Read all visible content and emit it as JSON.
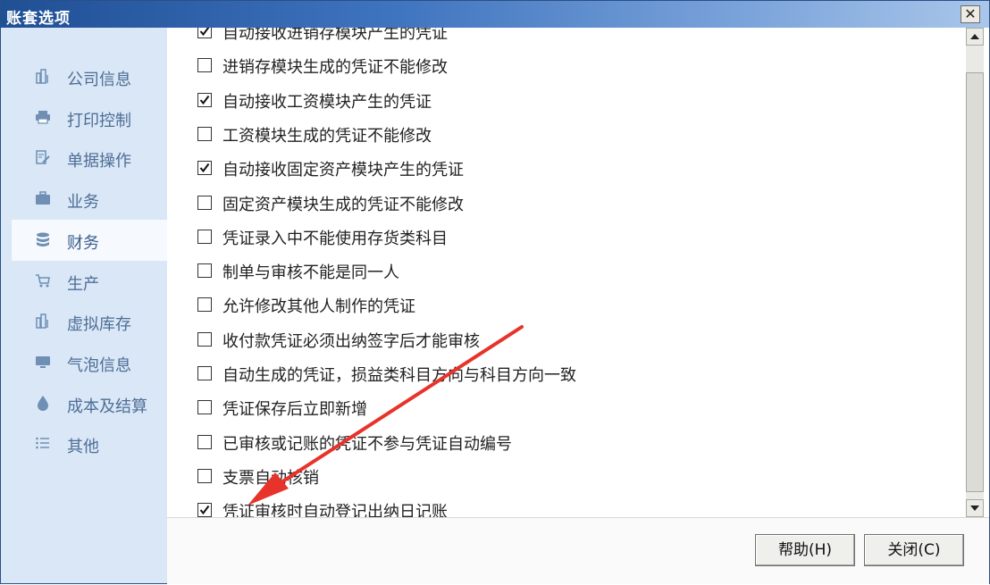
{
  "window": {
    "title": "账套选项"
  },
  "titlebar": {
    "close_glyph": "✕"
  },
  "sidebar": {
    "items": [
      {
        "label": "公司信息",
        "icon": "building-icon",
        "active": false
      },
      {
        "label": "打印控制",
        "icon": "printer-icon",
        "active": false
      },
      {
        "label": "单据操作",
        "icon": "document-edit-icon",
        "active": false
      },
      {
        "label": "业务",
        "icon": "briefcase-icon",
        "active": false
      },
      {
        "label": "财务",
        "icon": "database-icon",
        "active": true
      },
      {
        "label": "生产",
        "icon": "cart-icon",
        "active": false
      },
      {
        "label": "虚拟库存",
        "icon": "building-icon",
        "active": false
      },
      {
        "label": "气泡信息",
        "icon": "monitor-icon",
        "active": false
      },
      {
        "label": "成本及结算",
        "icon": "drop-icon",
        "active": false
      },
      {
        "label": "其他",
        "icon": "list-icon",
        "active": false
      }
    ]
  },
  "options": [
    {
      "label": "自动接收进销存模块产生的凭证",
      "checked": true
    },
    {
      "label": "进销存模块生成的凭证不能修改",
      "checked": false
    },
    {
      "label": "自动接收工资模块产生的凭证",
      "checked": true
    },
    {
      "label": "工资模块生成的凭证不能修改",
      "checked": false
    },
    {
      "label": "自动接收固定资产模块产生的凭证",
      "checked": true
    },
    {
      "label": "固定资产模块生成的凭证不能修改",
      "checked": false
    },
    {
      "label": "凭证录入中不能使用存货类科目",
      "checked": false
    },
    {
      "label": "制单与审核不能是同一人",
      "checked": false
    },
    {
      "label": "允许修改其他人制作的凭证",
      "checked": false
    },
    {
      "label": "收付款凭证必须出纳签字后才能审核",
      "checked": false
    },
    {
      "label": "自动生成的凭证，损益类科目方向与科目方向一致",
      "checked": false
    },
    {
      "label": "凭证保存后立即新增",
      "checked": false
    },
    {
      "label": "已审核或记账的凭证不参与凭证自动编号",
      "checked": false
    },
    {
      "label": "支票自动核销",
      "checked": false
    },
    {
      "label": "凭证审核时自动登记出纳日记账",
      "checked": true
    }
  ],
  "footer": {
    "help_label": "帮助(H)",
    "close_label": "关闭(C)"
  },
  "colors": {
    "annotation_arrow": "#e8332a",
    "sidebar_bg": "#d9e7f7",
    "titlebar_start": "#1f4f95"
  }
}
